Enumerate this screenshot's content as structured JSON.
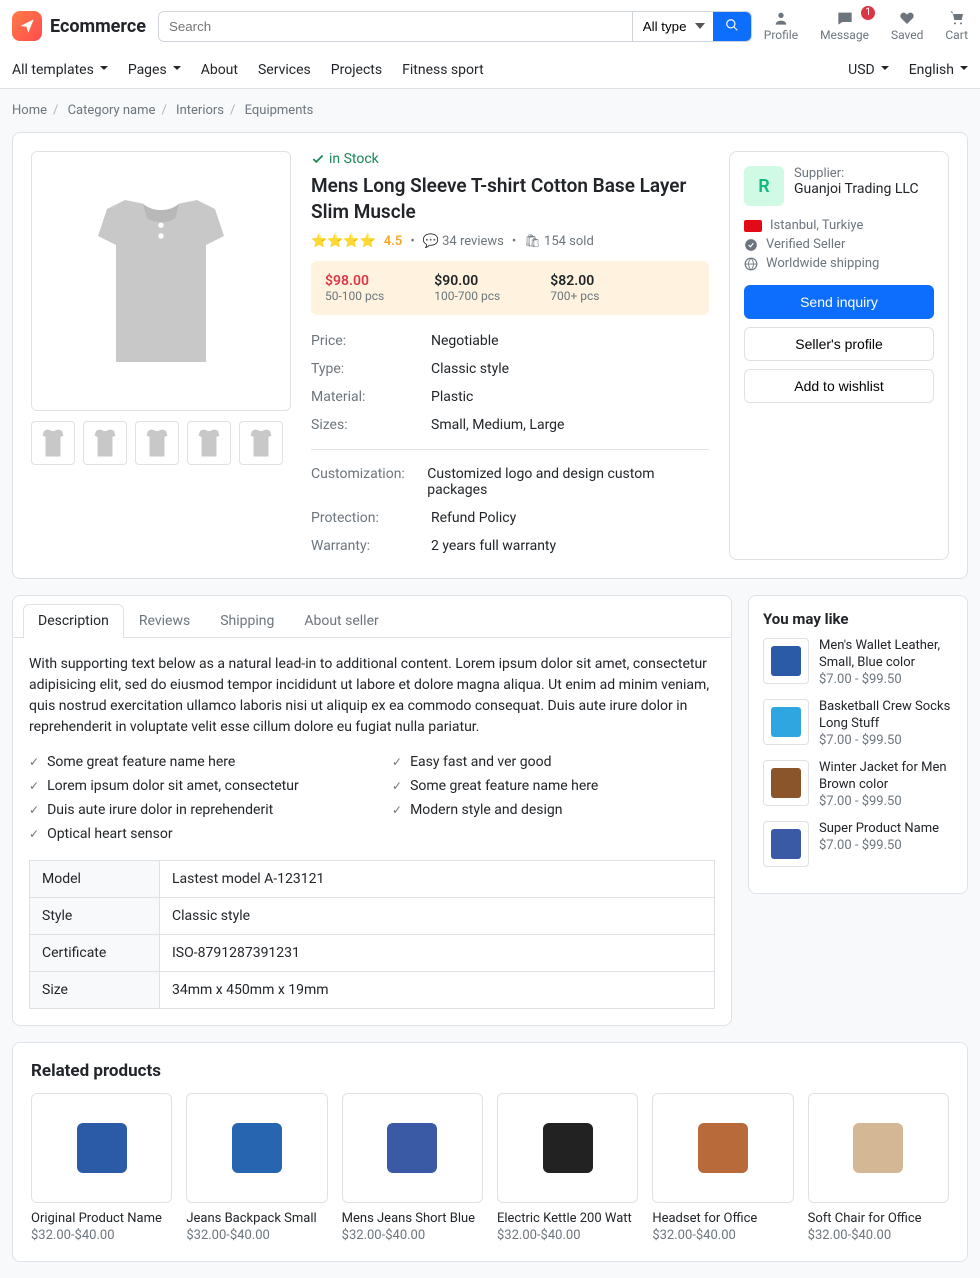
{
  "header": {
    "brand": "Ecommerce",
    "search_placeholder": "Search",
    "search_type": "All type",
    "user": {
      "profile": "Profile",
      "message": "Message",
      "message_badge": "1",
      "saved": "Saved",
      "cart": "Cart"
    },
    "nav": [
      "All templates",
      "Pages",
      "About",
      "Services",
      "Projects",
      "Fitness sport"
    ],
    "currency": "USD",
    "language": "English"
  },
  "breadcrumb": [
    "Home",
    "Category name",
    "Interiors",
    "Equipments"
  ],
  "product": {
    "stock": "in Stock",
    "title": "Mens Long Sleeve T-shirt Cotton Base Layer Slim Muscle",
    "rating": "4.5",
    "reviews": "34 reviews",
    "sold": "154 sold",
    "tiers": [
      {
        "price": "$98.00",
        "qty": "50-100 pcs"
      },
      {
        "price": "$90.00",
        "qty": "100-700 pcs"
      },
      {
        "price": "$82.00",
        "qty": "700+ pcs"
      }
    ],
    "specs1": [
      {
        "k": "Price:",
        "v": "Negotiable"
      },
      {
        "k": "Type:",
        "v": "Classic style"
      },
      {
        "k": "Material:",
        "v": "Plastic"
      },
      {
        "k": "Sizes:",
        "v": "Small, Medium, Large"
      }
    ],
    "specs2": [
      {
        "k": "Customization:",
        "v": "Customized logo and design custom packages"
      },
      {
        "k": "Protection:",
        "v": "Refund Policy"
      },
      {
        "k": "Warranty:",
        "v": "2 years full warranty"
      }
    ]
  },
  "supplier": {
    "label": "Supplier:",
    "name": "Guanjoi Trading LLC",
    "initial": "R",
    "location": "Istanbul, Turkiye",
    "verified": "Verified Seller",
    "shipping": "Worldwide shipping",
    "send": "Send inquiry",
    "profile": "Seller's profile",
    "wishlist": "Add to wishlist"
  },
  "tabs": {
    "list": [
      "Description",
      "Reviews",
      "Shipping",
      "About seller"
    ]
  },
  "desc": {
    "text": "With supporting text below as a natural lead-in to additional content. Lorem ipsum dolor sit amet, consectetur adipisicing elit, sed do eiusmod tempor incididunt ut labore et dolore magna aliqua. Ut enim ad minim veniam, quis nostrud exercitation ullamco laboris nisi ut aliquip ex ea commodo consequat. Duis aute irure dolor in reprehenderit in voluptate velit esse cillum dolore eu fugiat nulla pariatur.",
    "features1": [
      "Some great feature name here",
      "Lorem ipsum dolor sit amet, consectetur",
      "Duis aute irure dolor in reprehenderit",
      "Optical heart sensor"
    ],
    "features2": [
      "Easy fast and ver good",
      "Some great feature name here",
      "Modern style and design"
    ],
    "table": [
      {
        "k": "Model",
        "v": "Lastest model A-123121"
      },
      {
        "k": "Style",
        "v": "Classic style"
      },
      {
        "k": "Certificate",
        "v": "ISO-8791287391231"
      },
      {
        "k": "Size",
        "v": "34mm x 450mm x 19mm"
      }
    ]
  },
  "sidebar": {
    "title": "You may like",
    "items": [
      {
        "name": "Men's Wallet Leather, Small, Blue color",
        "price": "$7.00 - $99.50",
        "color": "#2b5aa6"
      },
      {
        "name": "Basketball Crew Socks Long Stuff",
        "price": "$7.00 - $99.50",
        "color": "#2fa6e0"
      },
      {
        "name": "Winter Jacket for Men Brown color",
        "price": "$7.00 - $99.50",
        "color": "#8a552b"
      },
      {
        "name": "Super Product Name",
        "price": "$7.00 - $99.50",
        "color": "#3b5aa6"
      }
    ]
  },
  "related": {
    "title": "Related products",
    "items": [
      {
        "name": "Original Product Name",
        "price": "$32.00-$40.00",
        "color": "#2b5aa6"
      },
      {
        "name": "Jeans Backpack Small",
        "price": "$32.00-$40.00",
        "color": "#2765b0"
      },
      {
        "name": "Mens Jeans Short Blue",
        "price": "$32.00-$40.00",
        "color": "#3b5aa6"
      },
      {
        "name": "Electric Kettle 200 Watt",
        "price": "$32.00-$40.00",
        "color": "#222"
      },
      {
        "name": "Headset for Office",
        "price": "$32.00-$40.00",
        "color": "#b86a3b"
      },
      {
        "name": "Soft Chair for Office",
        "price": "$32.00-$40.00",
        "color": "#d4b896"
      }
    ]
  }
}
